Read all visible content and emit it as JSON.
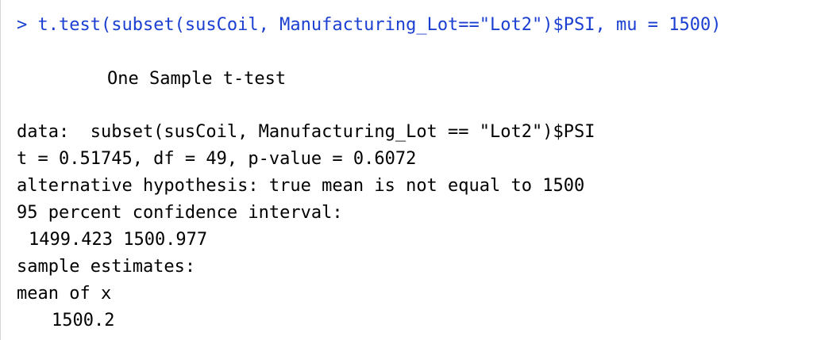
{
  "console": {
    "prompt": ">",
    "command": "t.test(subset(susCoil, Manufacturing_Lot==\"Lot2\")$PSI, mu = 1500)",
    "output": {
      "title": "One Sample t-test",
      "data_line": "data:  subset(susCoil, Manufacturing_Lot == \"Lot2\")$PSI",
      "stats_line": "t = 0.51745, df = 49, p-value = 0.6072",
      "alternative_line": "alternative hypothesis: true mean is not equal to 1500",
      "ci_label": "95 percent confidence interval:",
      "ci_values": "1499.423 1500.977",
      "estimates_label": "sample estimates:",
      "estimate_name": "mean of x",
      "estimate_value": "1500.2"
    }
  },
  "colors": {
    "command": "#1b3fd1",
    "output": "#000000",
    "background": "#ffffff"
  }
}
